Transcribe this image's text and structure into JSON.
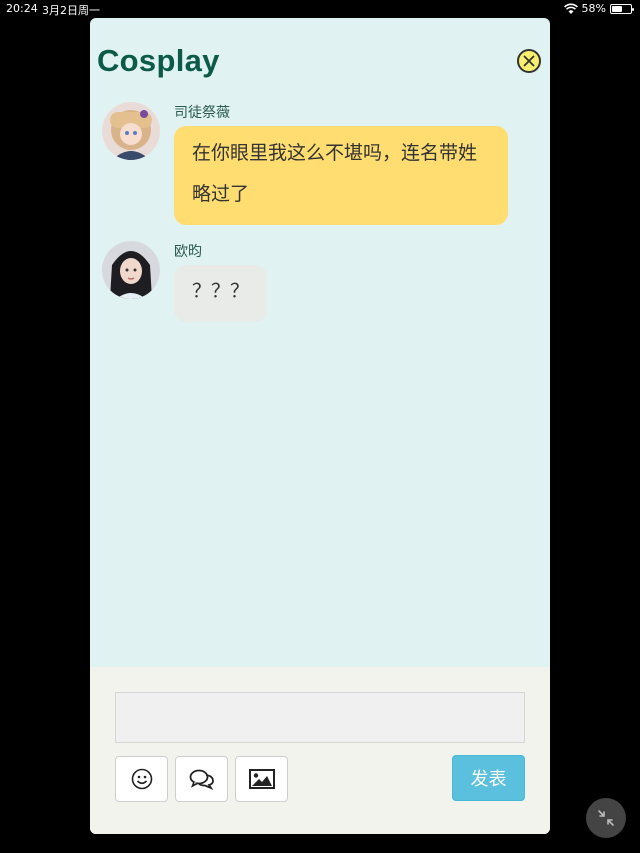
{
  "status_bar": {
    "time": "20:24",
    "date": "3月2日周一",
    "battery_percent": "58%",
    "battery_level": 0.58
  },
  "chat": {
    "title": "Cosplay",
    "messages": [
      {
        "sender": "司徒祭薇",
        "text": "在你眼里我这么不堪吗，连名带姓略过了",
        "bubble_color": "#ffdd70"
      },
      {
        "sender": "欧昀",
        "text": "？？？",
        "bubble_color": "#e8ebe8"
      }
    ]
  },
  "composer": {
    "input_value": "",
    "send_label": "发表"
  },
  "icons": [
    "close-icon",
    "emoji-icon",
    "chat-bubbles-icon",
    "image-icon",
    "minimize-icon"
  ],
  "colors": {
    "title": "#0c5a48",
    "panel_bg": "#e0f2f2",
    "send_button": "#5bc0de"
  }
}
